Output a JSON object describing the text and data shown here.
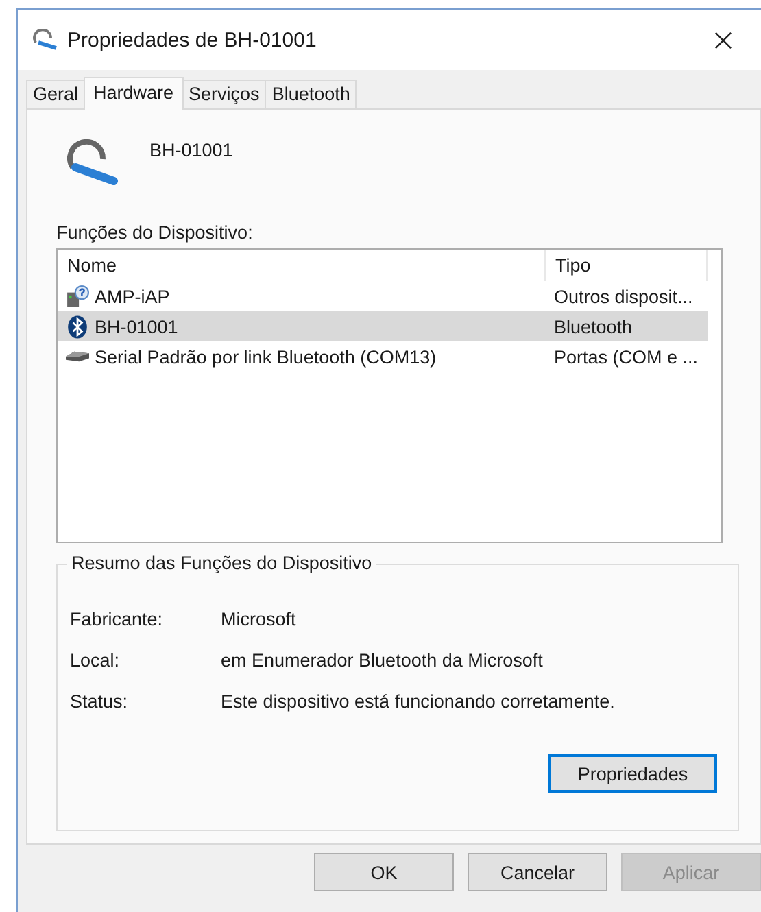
{
  "window": {
    "title": "Propriedades de BH-01001"
  },
  "tabs": [
    {
      "label": "Geral",
      "selected": false
    },
    {
      "label": "Hardware",
      "selected": true
    },
    {
      "label": "Serviços",
      "selected": false
    },
    {
      "label": "Bluetooth",
      "selected": false
    }
  ],
  "device": {
    "name": "BH-01001"
  },
  "functions": {
    "label": "Funções do Dispositivo:",
    "columns": [
      "Nome",
      "Tipo"
    ],
    "rows": [
      {
        "kind": "unknown",
        "name": "AMP-iAP",
        "type": "Outros disposit...",
        "selected": false
      },
      {
        "kind": "bluetooth",
        "name": "BH-01001",
        "type": "Bluetooth",
        "selected": true
      },
      {
        "kind": "port",
        "name": "Serial Padrão por link Bluetooth (COM13)",
        "type": "Portas (COM e ...",
        "selected": false
      }
    ]
  },
  "summary": {
    "title": "Resumo das Funções do Dispositivo",
    "fields": [
      {
        "label": "Fabricante:",
        "value": "Microsoft"
      },
      {
        "label": "Local:",
        "value": "em Enumerador Bluetooth da Microsoft"
      },
      {
        "label": "Status:",
        "value": "Este dispositivo está funcionando corretamente."
      }
    ],
    "button": "Propriedades"
  },
  "buttons": [
    {
      "label": "OK",
      "disabled": false
    },
    {
      "label": "Cancelar",
      "disabled": false
    },
    {
      "label": "Aplicar",
      "disabled": true
    }
  ]
}
